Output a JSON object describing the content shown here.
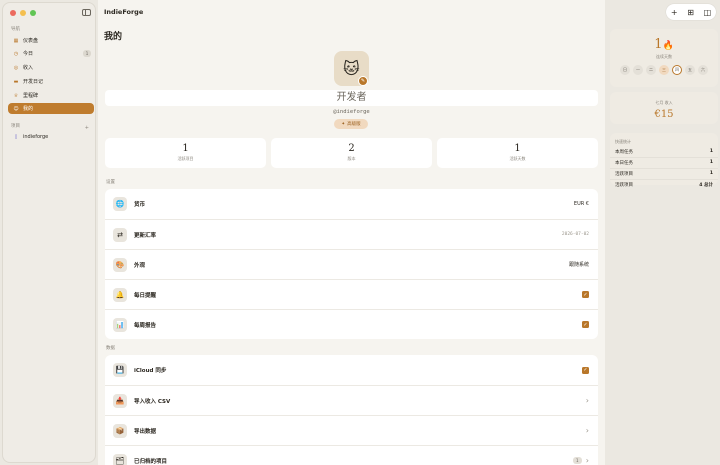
{
  "app": {
    "title": "IndieForge"
  },
  "sidebar": {
    "section_label": "导航",
    "items": [
      {
        "label": "仪表盘",
        "icon": "grid-icon"
      },
      {
        "label": "今日",
        "icon": "calendar-icon",
        "badge": "1"
      },
      {
        "label": "收入",
        "icon": "coin-icon"
      },
      {
        "label": "开发日记",
        "icon": "book-icon"
      },
      {
        "label": "里程碑",
        "icon": "trophy-icon"
      },
      {
        "label": "我的",
        "icon": "person-icon",
        "active": true
      }
    ],
    "projects_label": "项目",
    "projects_add": "+",
    "projects": [
      {
        "label": "indieforge",
        "icon": "phone-icon"
      }
    ]
  },
  "main": {
    "page_title": "我的",
    "profile": {
      "avatar_emoji": "🐱",
      "name": "开发者",
      "handle": "@indieforge",
      "level": "高级版"
    },
    "stats": [
      {
        "value": "1",
        "label": "活跃项目"
      },
      {
        "value": "2",
        "label": "版本"
      },
      {
        "value": "1",
        "label": "活跃天数"
      }
    ],
    "settings_label": "设置",
    "settings": [
      {
        "label": "货币",
        "icon": "globe-icon",
        "value": "EUR €"
      },
      {
        "label": "更新汇率",
        "icon": "exchange-icon",
        "value": "2026-07-02"
      },
      {
        "label": "外观",
        "icon": "palette-icon",
        "value": "跟随系统"
      },
      {
        "label": "每日提醒",
        "icon": "bell-icon",
        "checked": true
      },
      {
        "label": "每周报告",
        "icon": "chart-icon",
        "checked": true
      }
    ],
    "data_label": "数据",
    "data_rows": [
      {
        "label": "iCloud 同步",
        "icon": "save-icon",
        "checked": true
      },
      {
        "label": "导入收入 CSV",
        "icon": "inbox-icon"
      },
      {
        "label": "导出数据",
        "icon": "box-icon"
      },
      {
        "label": "已归档的项目",
        "icon": "archive-icon",
        "badge": "1"
      }
    ]
  },
  "right": {
    "streak": {
      "value": "1",
      "label": "连续天数",
      "days": [
        "日",
        "一",
        "二",
        "三",
        "四",
        "五",
        "六"
      ],
      "done_index": 3,
      "today_index": 4
    },
    "income": {
      "label": "七月 收入",
      "value": "€15"
    },
    "quick_stats": {
      "title": "快速统计",
      "rows": [
        {
          "label": "本周任务",
          "value": "1"
        },
        {
          "label": "本日任务",
          "value": "1"
        },
        {
          "label": "活跃项目",
          "value": "1"
        },
        {
          "label": "活跃项目",
          "value": "4 总计"
        }
      ]
    }
  },
  "colors": {
    "accent": "#bf7c2e",
    "background": "#f6f4ef"
  }
}
